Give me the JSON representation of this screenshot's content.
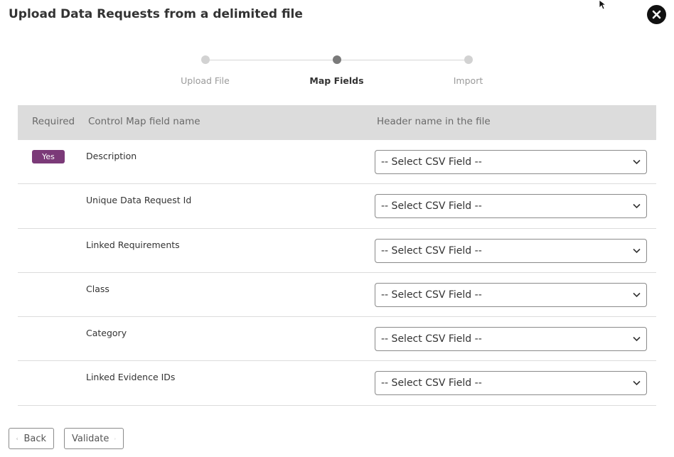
{
  "dialog": {
    "title": "Upload Data Requests from a delimited file"
  },
  "stepper": {
    "steps": [
      {
        "label": "Upload File",
        "active": false
      },
      {
        "label": "Map Fields",
        "active": true
      },
      {
        "label": "Import",
        "active": false
      }
    ]
  },
  "table": {
    "headers": {
      "required": "Required",
      "field": "Control Map field name",
      "header": "Header name in the file"
    },
    "rows": [
      {
        "required": "Yes",
        "field": "Description",
        "select": "-- Select CSV Field --"
      },
      {
        "required": "",
        "field": "Unique Data Request Id",
        "select": "-- Select CSV Field --"
      },
      {
        "required": "",
        "field": "Linked Requirements",
        "select": "-- Select CSV Field --"
      },
      {
        "required": "",
        "field": "Class",
        "select": "-- Select CSV Field --"
      },
      {
        "required": "",
        "field": "Category",
        "select": "-- Select CSV Field --"
      },
      {
        "required": "",
        "field": "Linked Evidence IDs",
        "select": "-- Select CSV Field --"
      }
    ]
  },
  "footer": {
    "back_label": "Back",
    "validate_label": "Validate"
  },
  "colors": {
    "badge": "#7b3a78",
    "header_bg": "#dcdcdc"
  }
}
